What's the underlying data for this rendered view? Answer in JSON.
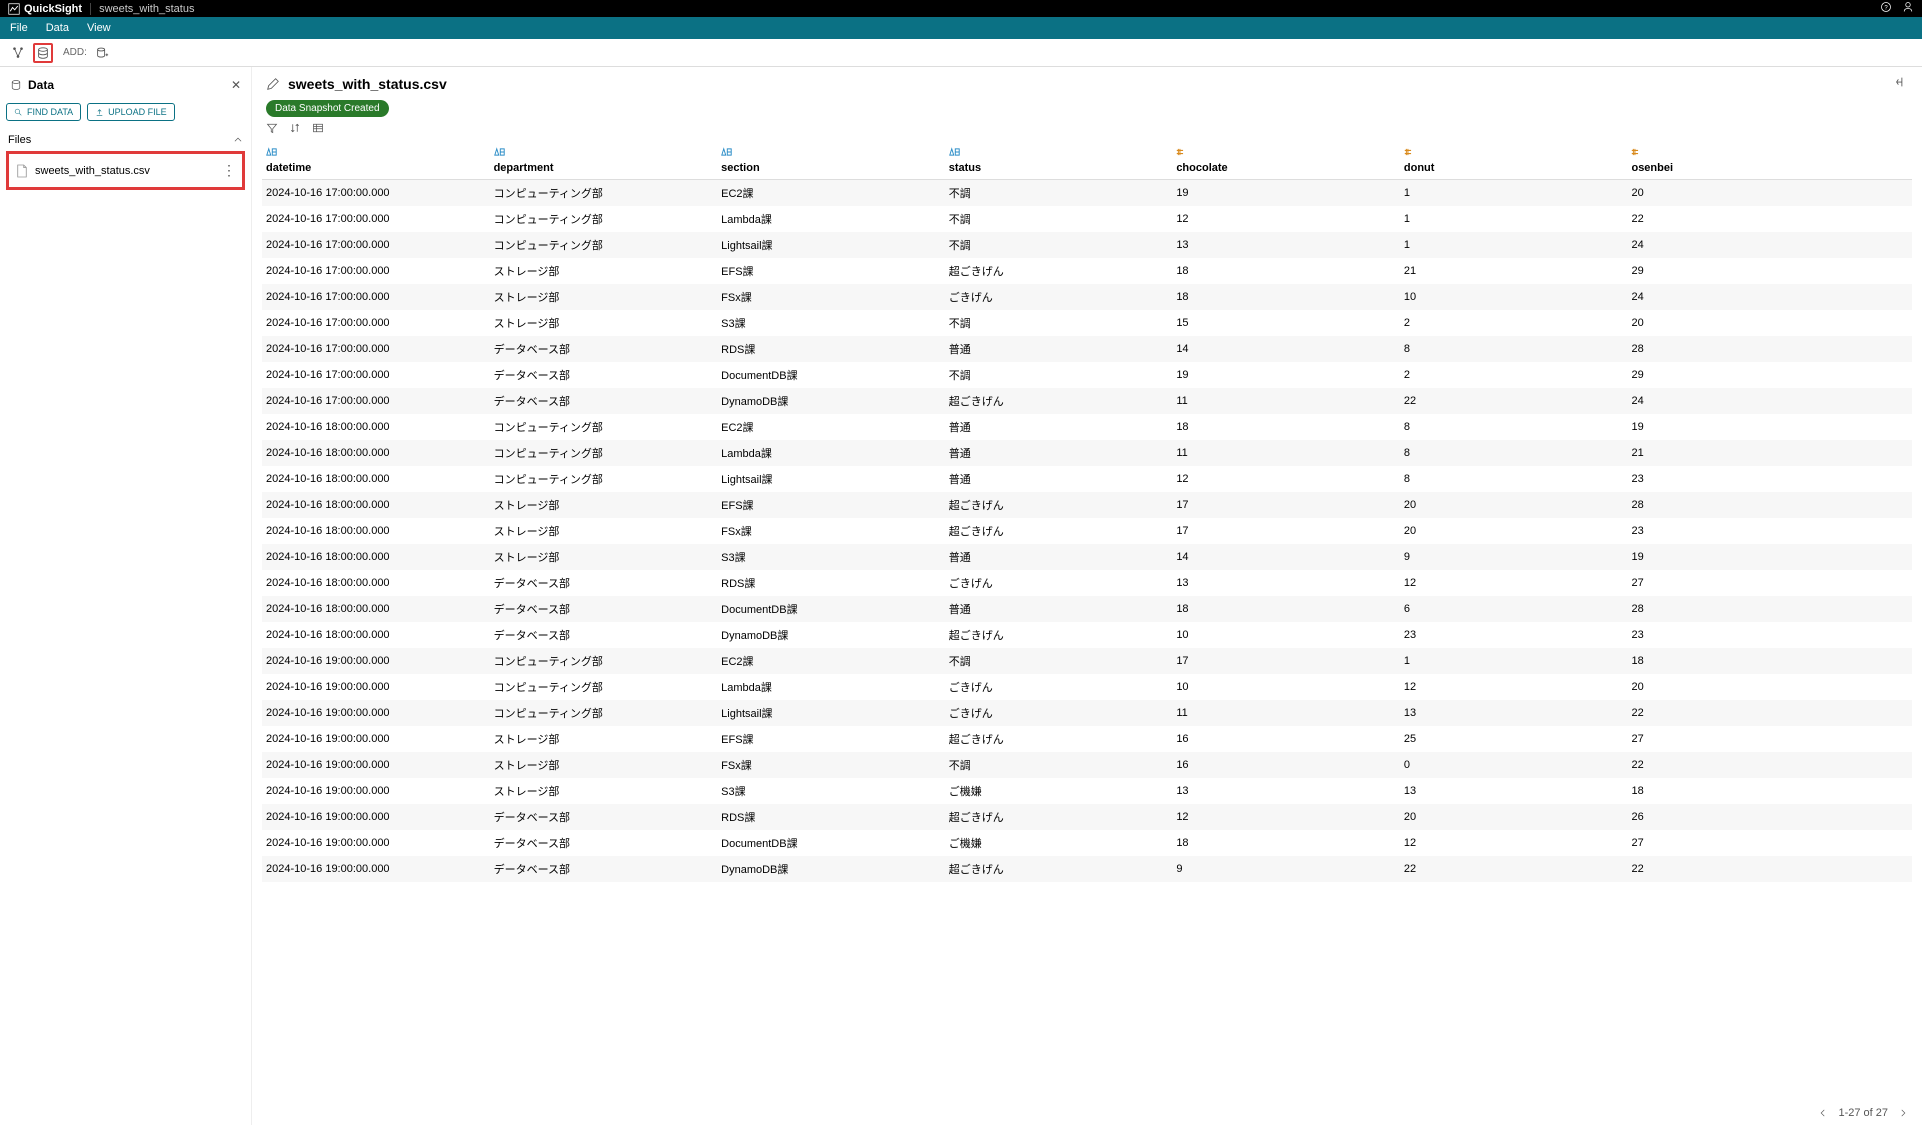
{
  "header": {
    "app": "QuickSight",
    "doc": "sweets_with_status"
  },
  "menu": {
    "file": "File",
    "data": "Data",
    "view": "View"
  },
  "toolbar": {
    "add": "ADD:"
  },
  "sidebar": {
    "title": "Data",
    "find": "FIND DATA",
    "upload": "UPLOAD FILE",
    "section": "Files",
    "file": "sweets_with_status.csv"
  },
  "dataset": {
    "title": "sweets_with_status.csv",
    "badge": "Data Snapshot Created"
  },
  "columns": [
    {
      "name": "datetime",
      "type": "str"
    },
    {
      "name": "department",
      "type": "str"
    },
    {
      "name": "section",
      "type": "str"
    },
    {
      "name": "status",
      "type": "str"
    },
    {
      "name": "chocolate",
      "type": "num"
    },
    {
      "name": "donut",
      "type": "num"
    },
    {
      "name": "osenbei",
      "type": "num"
    }
  ],
  "rows": [
    [
      "2024-10-16 17:00:00.000",
      "コンピューティング部",
      "EC2課",
      "不調",
      "19",
      "1",
      "20"
    ],
    [
      "2024-10-16 17:00:00.000",
      "コンピューティング部",
      "Lambda課",
      "不調",
      "12",
      "1",
      "22"
    ],
    [
      "2024-10-16 17:00:00.000",
      "コンピューティング部",
      "Lightsail課",
      "不調",
      "13",
      "1",
      "24"
    ],
    [
      "2024-10-16 17:00:00.000",
      "ストレージ部",
      "EFS課",
      "超ごきげん",
      "18",
      "21",
      "29"
    ],
    [
      "2024-10-16 17:00:00.000",
      "ストレージ部",
      "FSx課",
      "ごきげん",
      "18",
      "10",
      "24"
    ],
    [
      "2024-10-16 17:00:00.000",
      "ストレージ部",
      "S3課",
      "不調",
      "15",
      "2",
      "20"
    ],
    [
      "2024-10-16 17:00:00.000",
      "データベース部",
      "RDS課",
      "普通",
      "14",
      "8",
      "28"
    ],
    [
      "2024-10-16 17:00:00.000",
      "データベース部",
      "DocumentDB課",
      "不調",
      "19",
      "2",
      "29"
    ],
    [
      "2024-10-16 17:00:00.000",
      "データベース部",
      "DynamoDB課",
      "超ごきげん",
      "11",
      "22",
      "24"
    ],
    [
      "2024-10-16 18:00:00.000",
      "コンピューティング部",
      "EC2課",
      "普通",
      "18",
      "8",
      "19"
    ],
    [
      "2024-10-16 18:00:00.000",
      "コンピューティング部",
      "Lambda課",
      "普通",
      "11",
      "8",
      "21"
    ],
    [
      "2024-10-16 18:00:00.000",
      "コンピューティング部",
      "Lightsail課",
      "普通",
      "12",
      "8",
      "23"
    ],
    [
      "2024-10-16 18:00:00.000",
      "ストレージ部",
      "EFS課",
      "超ごきげん",
      "17",
      "20",
      "28"
    ],
    [
      "2024-10-16 18:00:00.000",
      "ストレージ部",
      "FSx課",
      "超ごきげん",
      "17",
      "20",
      "23"
    ],
    [
      "2024-10-16 18:00:00.000",
      "ストレージ部",
      "S3課",
      "普通",
      "14",
      "9",
      "19"
    ],
    [
      "2024-10-16 18:00:00.000",
      "データベース部",
      "RDS課",
      "ごきげん",
      "13",
      "12",
      "27"
    ],
    [
      "2024-10-16 18:00:00.000",
      "データベース部",
      "DocumentDB課",
      "普通",
      "18",
      "6",
      "28"
    ],
    [
      "2024-10-16 18:00:00.000",
      "データベース部",
      "DynamoDB課",
      "超ごきげん",
      "10",
      "23",
      "23"
    ],
    [
      "2024-10-16 19:00:00.000",
      "コンピューティング部",
      "EC2課",
      "不調",
      "17",
      "1",
      "18"
    ],
    [
      "2024-10-16 19:00:00.000",
      "コンピューティング部",
      "Lambda課",
      "ごきげん",
      "10",
      "12",
      "20"
    ],
    [
      "2024-10-16 19:00:00.000",
      "コンピューティング部",
      "Lightsail課",
      "ごきげん",
      "11",
      "13",
      "22"
    ],
    [
      "2024-10-16 19:00:00.000",
      "ストレージ部",
      "EFS課",
      "超ごきげん",
      "16",
      "25",
      "27"
    ],
    [
      "2024-10-16 19:00:00.000",
      "ストレージ部",
      "FSx課",
      "不調",
      "16",
      "0",
      "22"
    ],
    [
      "2024-10-16 19:00:00.000",
      "ストレージ部",
      "S3課",
      "ご機嫌",
      "13",
      "13",
      "18"
    ],
    [
      "2024-10-16 19:00:00.000",
      "データベース部",
      "RDS課",
      "超ごきげん",
      "12",
      "20",
      "26"
    ],
    [
      "2024-10-16 19:00:00.000",
      "データベース部",
      "DocumentDB課",
      "ご機嫌",
      "18",
      "12",
      "27"
    ],
    [
      "2024-10-16 19:00:00.000",
      "データベース部",
      "DynamoDB課",
      "超ごきげん",
      "9",
      "22",
      "22"
    ]
  ],
  "pager": {
    "text": "1-27 of 27"
  }
}
